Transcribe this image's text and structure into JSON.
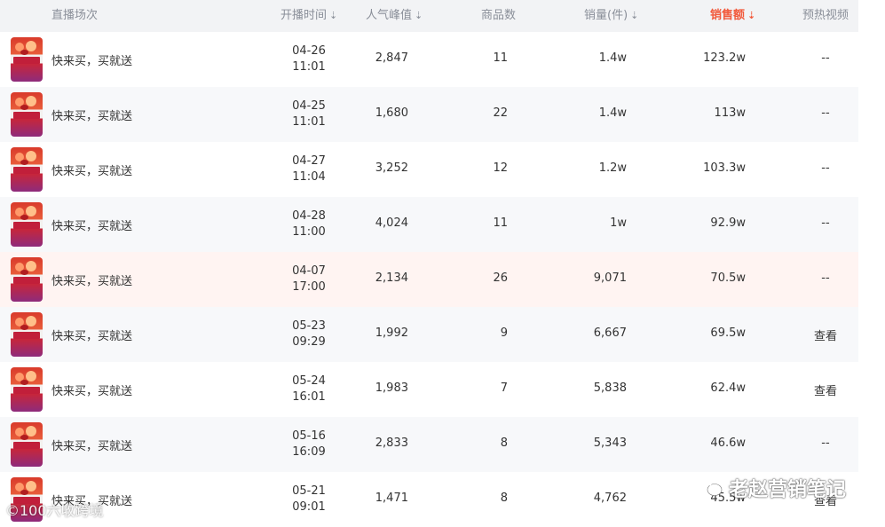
{
  "header": {
    "session": "直播场次",
    "start_time": "开播时间",
    "popularity": "人气峰值",
    "products": "商品数",
    "sales_volume": "销量(件)",
    "sales_amount": "销售额",
    "preheat_video": "预热视频",
    "sort_arrow": "⇣"
  },
  "accent_color": "#f25a3c",
  "rows": [
    {
      "title": "快来买，买就送",
      "date": "04-26",
      "time": "11:01",
      "popularity": "2,847",
      "products": "11",
      "sales": "1.4w",
      "amount": "123.2w",
      "video": "--"
    },
    {
      "title": "快来买，买就送",
      "date": "04-25",
      "time": "11:01",
      "popularity": "1,680",
      "products": "22",
      "sales": "1.4w",
      "amount": "113w",
      "video": "--"
    },
    {
      "title": "快来买，买就送",
      "date": "04-27",
      "time": "11:04",
      "popularity": "3,252",
      "products": "12",
      "sales": "1.2w",
      "amount": "103.3w",
      "video": "--"
    },
    {
      "title": "快来买，买就送",
      "date": "04-28",
      "time": "11:00",
      "popularity": "4,024",
      "products": "11",
      "sales": "1w",
      "amount": "92.9w",
      "video": "--"
    },
    {
      "title": "快来买，买就送",
      "date": "04-07",
      "time": "17:00",
      "popularity": "2,134",
      "products": "26",
      "sales": "9,071",
      "amount": "70.5w",
      "video": "--"
    },
    {
      "title": "快来买，买就送",
      "date": "05-23",
      "time": "09:29",
      "popularity": "1,992",
      "products": "9",
      "sales": "6,667",
      "amount": "69.5w",
      "video": "查看"
    },
    {
      "title": "快来买，买就送",
      "date": "05-24",
      "time": "16:01",
      "popularity": "1,983",
      "products": "7",
      "sales": "5,838",
      "amount": "62.4w",
      "video": "查看"
    },
    {
      "title": "快来买，买就送",
      "date": "05-16",
      "time": "16:09",
      "popularity": "2,833",
      "products": "8",
      "sales": "5,343",
      "amount": "46.6w",
      "video": "--"
    },
    {
      "title": "快来买，买就送",
      "date": "05-21",
      "time": "09:01",
      "popularity": "1,471",
      "products": "8",
      "sales": "4,762",
      "amount": "45.5w",
      "video": "查看"
    }
  ],
  "watermarks": {
    "left": "©100六收跨境",
    "right": "老赵营销笔记"
  }
}
